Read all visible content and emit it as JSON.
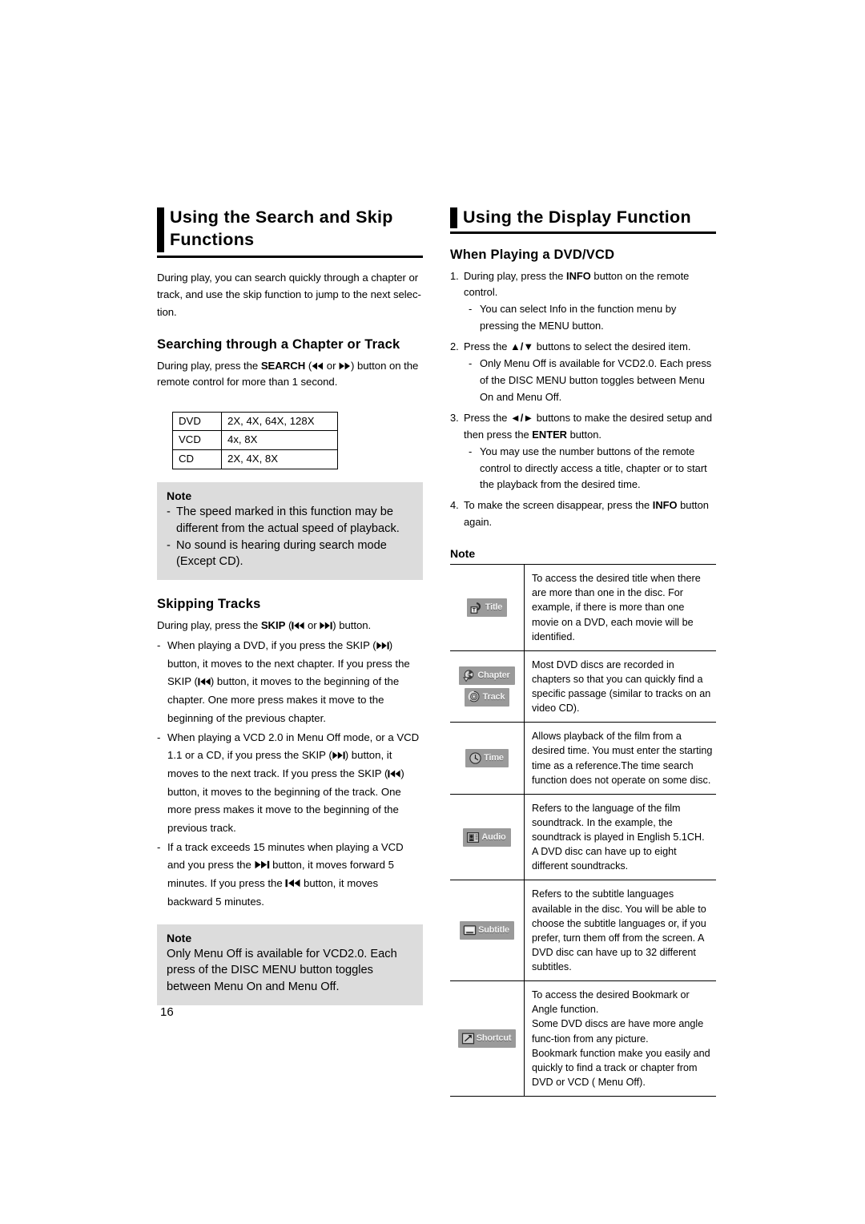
{
  "page": {
    "number": "16"
  },
  "left_column": {
    "heading": "Using the Search and Skip Functions",
    "intro": "During play, you can search quickly through a chapter or track, and use the skip function to jump to the next selec-tion.",
    "search_section": {
      "heading": "Searching through a Chapter or Track",
      "body_before": "During play, press the ",
      "body_bold": "SEARCH",
      "body_mid": " (",
      "rew_icon": "rewind-icon",
      "body_or": " or ",
      "ff_icon": "fast-forward-icon",
      "body_after": ") button on the remote control for more than 1 second."
    },
    "speed_table": {
      "rows": [
        {
          "media": "DVD",
          "speeds": "2X, 4X, 64X, 128X"
        },
        {
          "media": "VCD",
          "speeds": "4x, 8X"
        },
        {
          "media": "CD",
          "speeds": "2X, 4X, 8X"
        }
      ]
    },
    "note_search": {
      "title": "Note",
      "items": [
        "The speed marked in this function may be different from the actual speed of playback.",
        "No sound is hearing during search mode (Except CD)."
      ]
    },
    "skip_section": {
      "heading": "Skipping Tracks",
      "intro_before": "During play, press the ",
      "intro_bold": "SKIP",
      "intro_mid": " (",
      "intro_or": " or ",
      "intro_after": ") button.",
      "items": [
        {
          "seg1": "When playing a DVD, if you press the SKIP (",
          "icon1": "skip-next-icon",
          "seg2": ") button, it moves to the next chapter. If you press the SKIP (",
          "icon2": "skip-prev-icon",
          "seg3": ") button, it moves to the beginning of the chapter. One more press makes it move to the beginning of the previous chapter."
        },
        {
          "seg1": "When playing a VCD 2.0 in Menu Off mode, or a VCD 1.1 or a CD, if you press the SKIP (",
          "icon1": "skip-next-icon",
          "seg2": ") button, it moves to the next track. If you press the SKIP (",
          "icon2": "skip-prev-icon",
          "seg3": ") button, it moves to the beginning of the track. One more press makes it move to the beginning of the previous track."
        },
        {
          "seg1": "If a track exceeds 15 minutes when playing a VCD and you press the ",
          "icon1": "skip-next-icon",
          "seg2": " button, it moves forward 5 minutes. If you press the ",
          "icon2": "skip-prev-icon",
          "seg3": " button, it moves backward 5 minutes."
        }
      ]
    },
    "note_skip": {
      "title": "Note",
      "text": "Only Menu Off is available for VCD2.0. Each press of the DISC MENU button toggles between Menu On and Menu Off."
    }
  },
  "right_column": {
    "heading": "Using the Display Function",
    "sub_heading": "When Playing a DVD/VCD",
    "steps": [
      {
        "num": "1.",
        "before": "During play, press the ",
        "bold": "INFO",
        "after": " button on the remote control.",
        "subitems": [
          "You can select Info in the function menu by pressing the MENU button."
        ]
      },
      {
        "num": "2.",
        "before": "Press the ",
        "arrows": "▲/▼",
        "after": " buttons to select the desired item.",
        "subitems": [
          "Only Menu Off is available for VCD2.0. Each press of the DISC MENU button toggles between Menu On and Menu Off."
        ]
      },
      {
        "num": "3.",
        "before": "Press the ",
        "arrows": "◄/►",
        "mid": " buttons to make the desired setup and then press the ",
        "bold": "ENTER",
        "after": " button.",
        "subitems": [
          "You may use the number buttons of the remote control to directly access a title, chapter or to start the playback from the desired time."
        ]
      },
      {
        "num": "4.",
        "before": "To make the screen disappear, press the ",
        "bold": "INFO",
        "after": " button again.",
        "subitems": []
      }
    ],
    "note_label": "Note",
    "icon_table": {
      "rows": [
        {
          "chips": [
            {
              "icon": "title-icon",
              "label": "Title"
            }
          ],
          "description": "To access the desired title when there are more than one in the disc. For example, if there is more than one movie on a DVD, each movie will be identified."
        },
        {
          "chips": [
            {
              "icon": "chapter-icon",
              "label": "Chapter"
            },
            {
              "icon": "track-icon",
              "label": "Track"
            }
          ],
          "description": "Most DVD discs are recorded in chapters so that you can quickly find a specific passage (similar to tracks on an video CD)."
        },
        {
          "chips": [
            {
              "icon": "time-icon",
              "label": "Time"
            }
          ],
          "description": "Allows playback of the film from a desired time. You must enter the starting time as a reference.The time search function does not operate on some disc."
        },
        {
          "chips": [
            {
              "icon": "audio-icon",
              "label": "Audio"
            }
          ],
          "description": "Refers to the language of the film soundtrack. In the example, the soundtrack is played in English 5.1CH. A DVD disc can have up to eight different soundtracks."
        },
        {
          "chips": [
            {
              "icon": "subtitle-icon",
              "label": "Subtitle"
            }
          ],
          "description": "Refers to the subtitle languages available in the disc. You will be able to choose the subtitle languages or, if you prefer, turn them off from the screen. A DVD disc can have up to 32 different subtitles."
        },
        {
          "chips": [
            {
              "icon": "shortcut-icon",
              "label": "Shortcut"
            }
          ],
          "description": "To access the desired Bookmark or Angle function.\nSome DVD discs are have more angle func-tion from any picture.\nBookmark function make you easily and quickly to find a track or chapter from DVD or VCD ( Menu Off)."
        }
      ]
    }
  },
  "colors": {
    "note_background": "#dcdcdc",
    "chip_background": "#9a9a9a",
    "rule": "#000000"
  }
}
